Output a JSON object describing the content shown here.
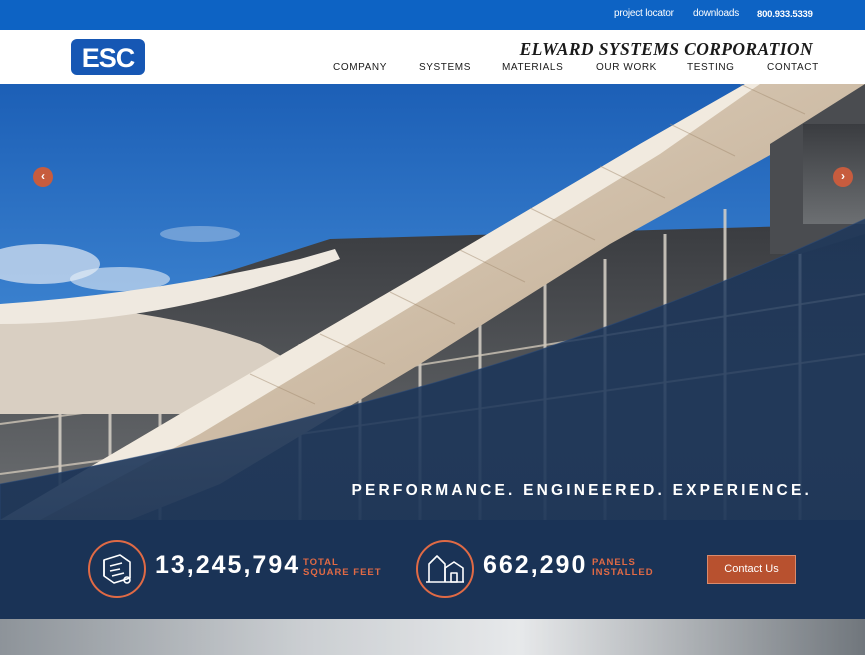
{
  "utility": {
    "project_locator": "project locator",
    "downloads": "downloads",
    "phone": "800.933.5339"
  },
  "header": {
    "logo_text": "ESC",
    "corp_name": "ELWARD SYSTEMS CORPORATION",
    "nav": [
      "COMPANY",
      "SYSTEMS",
      "MATERIALS",
      "OUR WORK",
      "TESTING",
      "CONTACT"
    ]
  },
  "hero": {
    "prev_arrow": "‹",
    "next_arrow": "›",
    "tagline": "PERFORMANCE. ENGINEERED. EXPERIENCE."
  },
  "stats": [
    {
      "icon": "blueprint-icon",
      "value": "13,245,794",
      "label_line1": "TOTAL",
      "label_line2": "SQUARE FEET"
    },
    {
      "icon": "building-icon",
      "value": "662,290",
      "label_line1": "PANELS",
      "label_line2": "INSTALLED"
    }
  ],
  "contact_button": "Contact Us",
  "colors": {
    "utility_bar": "#0d63c4",
    "accent": "#e06a45",
    "stats_bg": "#1a3356"
  }
}
